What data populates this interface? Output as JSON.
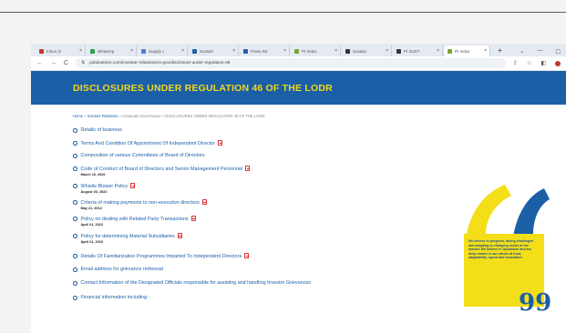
{
  "browser": {
    "tabs": [
      {
        "label": "Inbox (2",
        "color": "#c0392b"
      },
      {
        "label": "WhatsAp",
        "color": "#2e9e4f"
      },
      {
        "label": "Supply c",
        "color": "#4a7fd4"
      },
      {
        "label": "Sustain",
        "color": "#1b5fa7"
      },
      {
        "label": "Press Re",
        "color": "#1b5fa7"
      },
      {
        "label": "PI Indus",
        "color": "#7aa43a"
      },
      {
        "label": "Sustain",
        "color": "#333333"
      },
      {
        "label": "PI SUST",
        "color": "#333333"
      },
      {
        "label": "PI Indus",
        "color": "#7aa43a"
      }
    ],
    "new_tab": "+",
    "url": "piindustries.com/investor-relations/cs-gov/disclosure-under-regulation-46",
    "nav_back": "←",
    "nav_forward": "→",
    "nav_reload": "C"
  },
  "page": {
    "banner_title": "DISCLOSURES UNDER REGULATION 46 OF THE LODR",
    "breadcrumb": {
      "home": "Home",
      "sep1": " » ",
      "investor": "Investor Relations",
      "sep2": " » Corporate Governance » ",
      "current": "DISCLOSURES UNDER REGULATION 46 OF THE LODR"
    },
    "items": [
      {
        "label": "Details of business",
        "pdf": false,
        "date": ""
      },
      {
        "label": "Terms And Condition Of Appointment Of Independent Director",
        "pdf": true,
        "date": ""
      },
      {
        "label": "Composition of various Committees of Board of Directors",
        "pdf": false,
        "date": ""
      },
      {
        "label": "Code of Conduct of Board of Directors and Senior Management Personnel",
        "pdf": true,
        "date": "March 16, 2020"
      },
      {
        "label": "Whistle Blower Policy",
        "pdf": true,
        "date": "August 03, 2022"
      },
      {
        "label": "Criteria of making payments to non-executive directors",
        "pdf": true,
        "date": "May 21, 2014"
      },
      {
        "label": "Policy on dealing with Related Party Transactions",
        "pdf": true,
        "date": "April 01, 2022"
      },
      {
        "label": "Policy for determining Material Subsidiaries",
        "pdf": true,
        "date": "April 01, 2019"
      },
      {
        "label": "Details Of Familiarization Programmes Imparted To Independent Directors",
        "pdf": true,
        "date": ""
      },
      {
        "label": "Email address for grievance redressal",
        "pdf": false,
        "date": ""
      },
      {
        "label": "Contact Information of the Designated Officials responsible for assisting and handling Investor Grievances",
        "pdf": false,
        "date": ""
      },
      {
        "label": "Financial information including -",
        "pdf": false,
        "date": ""
      }
    ],
    "quote_text": "We believe in progress, facing challenges and adapting to changing needs of the market. We believe in dynamism and are deep rooted in our values of trust, adaptability, speed and innovation.",
    "quote_close": "99"
  },
  "colors": {
    "brand_blue": "#1b5fa7",
    "brand_yellow": "#f4de18"
  }
}
